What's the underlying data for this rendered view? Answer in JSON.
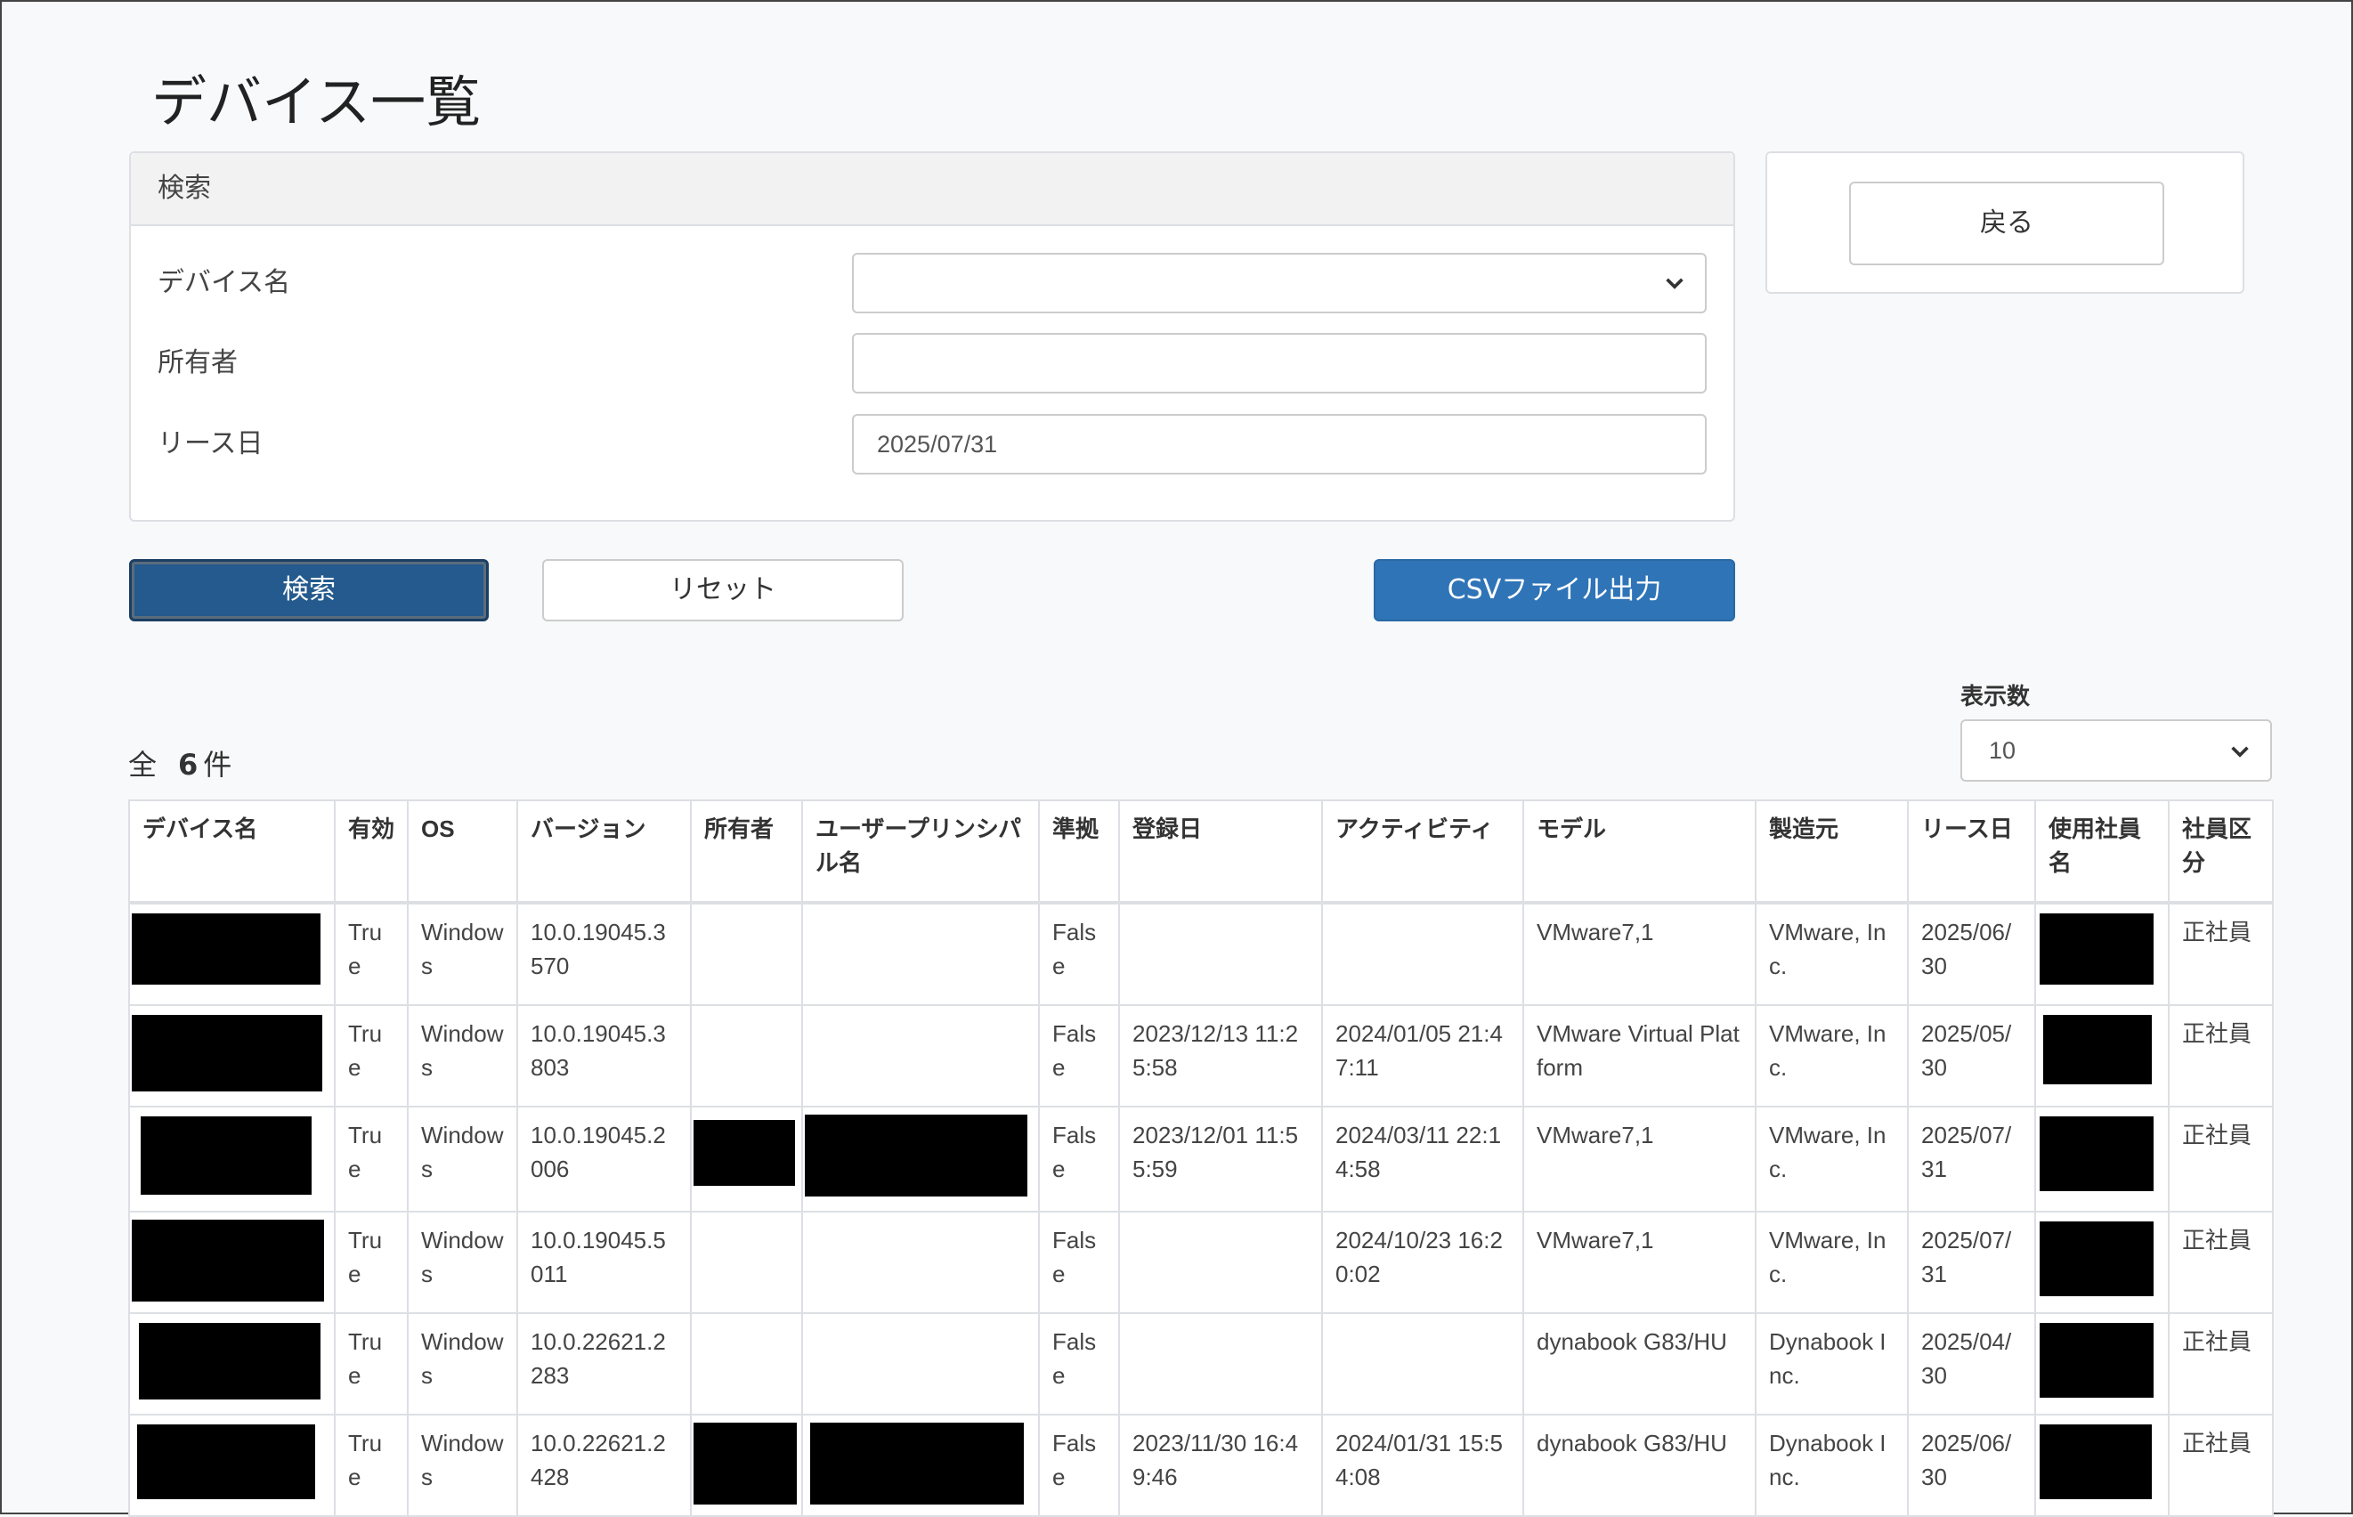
{
  "page": {
    "title": "デバイス一覧"
  },
  "search": {
    "header": "検索",
    "fields": {
      "device_name": {
        "label": "デバイス名",
        "value": ""
      },
      "owner": {
        "label": "所有者",
        "value": ""
      },
      "lease_date": {
        "label": "リース日",
        "value": "2025/07/31"
      }
    },
    "buttons": {
      "search": "検索",
      "reset": "リセット",
      "csv": "CSVファイル出力"
    }
  },
  "back_button": "戻る",
  "results": {
    "total_prefix": "全",
    "total_count": "6",
    "total_suffix": "件",
    "page_size_label": "表示数",
    "page_size_value": "10"
  },
  "table": {
    "columns": [
      "デバイス名",
      "有効",
      "OS",
      "バージョン",
      "所有者",
      "ユーザープリンシパル名",
      "準拠",
      "登録日",
      "アクティビティ",
      "モデル",
      "製造元",
      "リース日",
      "使用社員名",
      "社員区分"
    ],
    "rows": [
      {
        "enabled": "True",
        "os": "Windows",
        "version": "10.0.19045.3570",
        "compliant": "False",
        "registered": "",
        "activity": "",
        "model": "VMware7,1",
        "manufacturer": "VMware, Inc.",
        "lease_date": "2025/06/30",
        "employee_type": "正社員"
      },
      {
        "enabled": "True",
        "os": "Windows",
        "version": "10.0.19045.3803",
        "compliant": "False",
        "registered": "2023/12/13 11:25:58",
        "activity": "2024/01/05 21:47:11",
        "model": "VMware Virtual Platform",
        "manufacturer": "VMware, Inc.",
        "lease_date": "2025/05/30",
        "employee_type": "正社員"
      },
      {
        "enabled": "True",
        "os": "Windows",
        "version": "10.0.19045.2006",
        "compliant": "False",
        "registered": "2023/12/01 11:55:59",
        "activity": "2024/03/11 22:14:58",
        "model": "VMware7,1",
        "manufacturer": "VMware, Inc.",
        "lease_date": "2025/07/31",
        "employee_type": "正社員"
      },
      {
        "enabled": "True",
        "os": "Windows",
        "version": "10.0.19045.5011",
        "compliant": "False",
        "registered": "",
        "activity": "2024/10/23 16:20:02",
        "model": "VMware7,1",
        "manufacturer": "VMware, Inc.",
        "lease_date": "2025/07/31",
        "employee_type": "正社員"
      },
      {
        "enabled": "True",
        "os": "Windows",
        "version": "10.0.22621.2283",
        "compliant": "False",
        "registered": "",
        "activity": "",
        "model": "dynabook G83/HU",
        "manufacturer": "Dynabook Inc.",
        "lease_date": "2025/04/30",
        "employee_type": "正社員"
      },
      {
        "enabled": "True",
        "os": "Windows",
        "version": "10.0.22621.2428",
        "compliant": "False",
        "registered": "2023/11/30 16:49:46",
        "activity": "2024/01/31 15:54:08",
        "model": "dynabook G83/HU",
        "manufacturer": "Dynabook Inc.",
        "lease_date": "2025/06/30",
        "employee_type": "正社員"
      }
    ]
  },
  "colors": {
    "primary": "#2f74b7",
    "active_button": "#245a8d",
    "border": "#dcdfe3",
    "background": "#f8f9fa"
  },
  "icons": {
    "select_chevron": "chevron-down-icon"
  }
}
